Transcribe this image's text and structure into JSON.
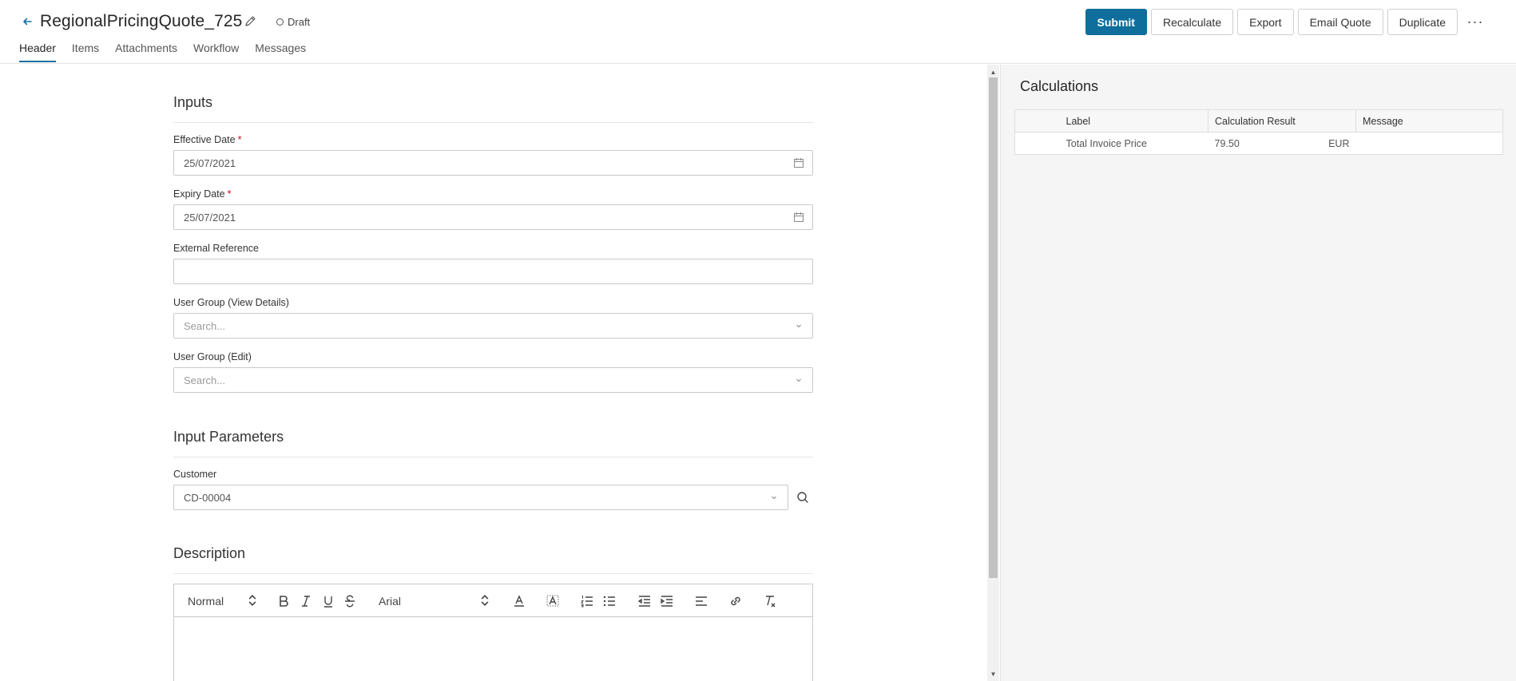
{
  "header": {
    "title": "RegionalPricingQuote_725",
    "status": "Draft",
    "tabs": [
      {
        "label": "Header",
        "active": true
      },
      {
        "label": "Items"
      },
      {
        "label": "Attachments"
      },
      {
        "label": "Workflow"
      },
      {
        "label": "Messages"
      }
    ],
    "actions": {
      "submit": "Submit",
      "recalculate": "Recalculate",
      "export": "Export",
      "email_quote": "Email Quote",
      "duplicate": "Duplicate",
      "more": "···"
    },
    "accent_color": "#0f6e9c"
  },
  "form": {
    "inputs_title": "Inputs",
    "effective_date": {
      "label": "Effective Date",
      "required_mark": "*",
      "value": "25/07/2021"
    },
    "expiry_date": {
      "label": "Expiry Date",
      "required_mark": "*",
      "value": "25/07/2021"
    },
    "external_reference": {
      "label": "External Reference",
      "value": ""
    },
    "user_group_view": {
      "label": "User Group (View Details)",
      "placeholder": "Search..."
    },
    "user_group_edit": {
      "label": "User Group (Edit)",
      "placeholder": "Search..."
    },
    "input_parameters_title": "Input Parameters",
    "customer": {
      "label": "Customer",
      "value": "CD-00004"
    },
    "description_title": "Description",
    "editor": {
      "block_format": "Normal",
      "font": "Arial"
    }
  },
  "calculations": {
    "title": "Calculations",
    "columns": [
      "Label",
      "Calculation Result",
      "Message"
    ],
    "rows": [
      {
        "label": "Total Invoice Price",
        "result": "79.50",
        "unit": "EUR",
        "message": ""
      }
    ]
  }
}
